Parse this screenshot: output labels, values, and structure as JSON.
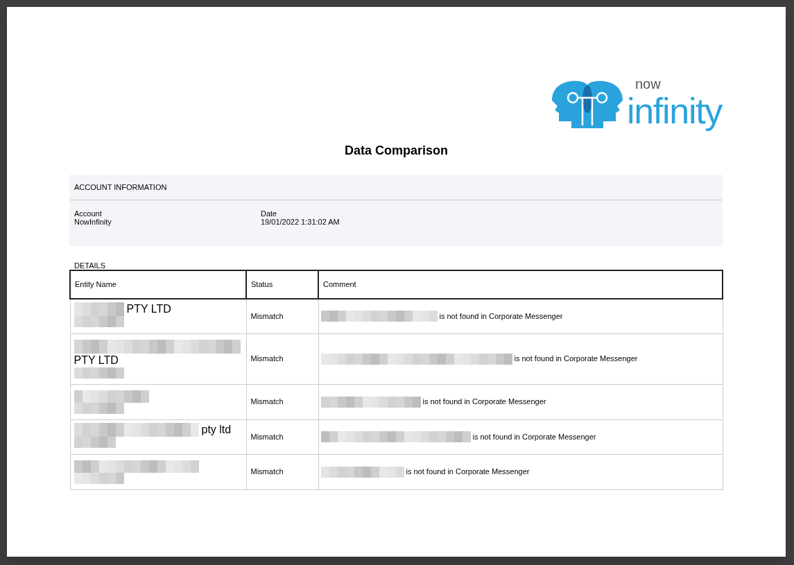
{
  "logo": {
    "word_top": "now",
    "word_main": "infinity"
  },
  "title": "Data Comparison",
  "account_information": {
    "heading": "ACCOUNT INFORMATION",
    "fields": [
      {
        "label": "Account",
        "value": "NowInfinity"
      },
      {
        "label": "Date",
        "value": "19/01/2022 1:31:02 AM"
      }
    ]
  },
  "details": {
    "heading": "DETAILS",
    "columns": [
      "Entity Name",
      "Status",
      "Comment"
    ],
    "rows": [
      {
        "kind": "inline",
        "entity_name": "PTY LTD",
        "status": "Mismatch",
        "comment": "is not found in Corporate Messenger"
      },
      {
        "kind": "stacked",
        "entity_name": "PTY LTD",
        "status": "Mismatch",
        "comment": "is not found in Corporate Messenger"
      },
      {
        "status": "Mismatch",
        "comment": "is not found in Corporate Messenger"
      },
      {
        "kind": "inline",
        "entity_name": "pty ltd",
        "status": "Mismatch",
        "comment": "is not found in Corporate Messenger"
      },
      {
        "status": "Mismatch",
        "comment": "is not found in Corporate Messenger"
      }
    ]
  }
}
